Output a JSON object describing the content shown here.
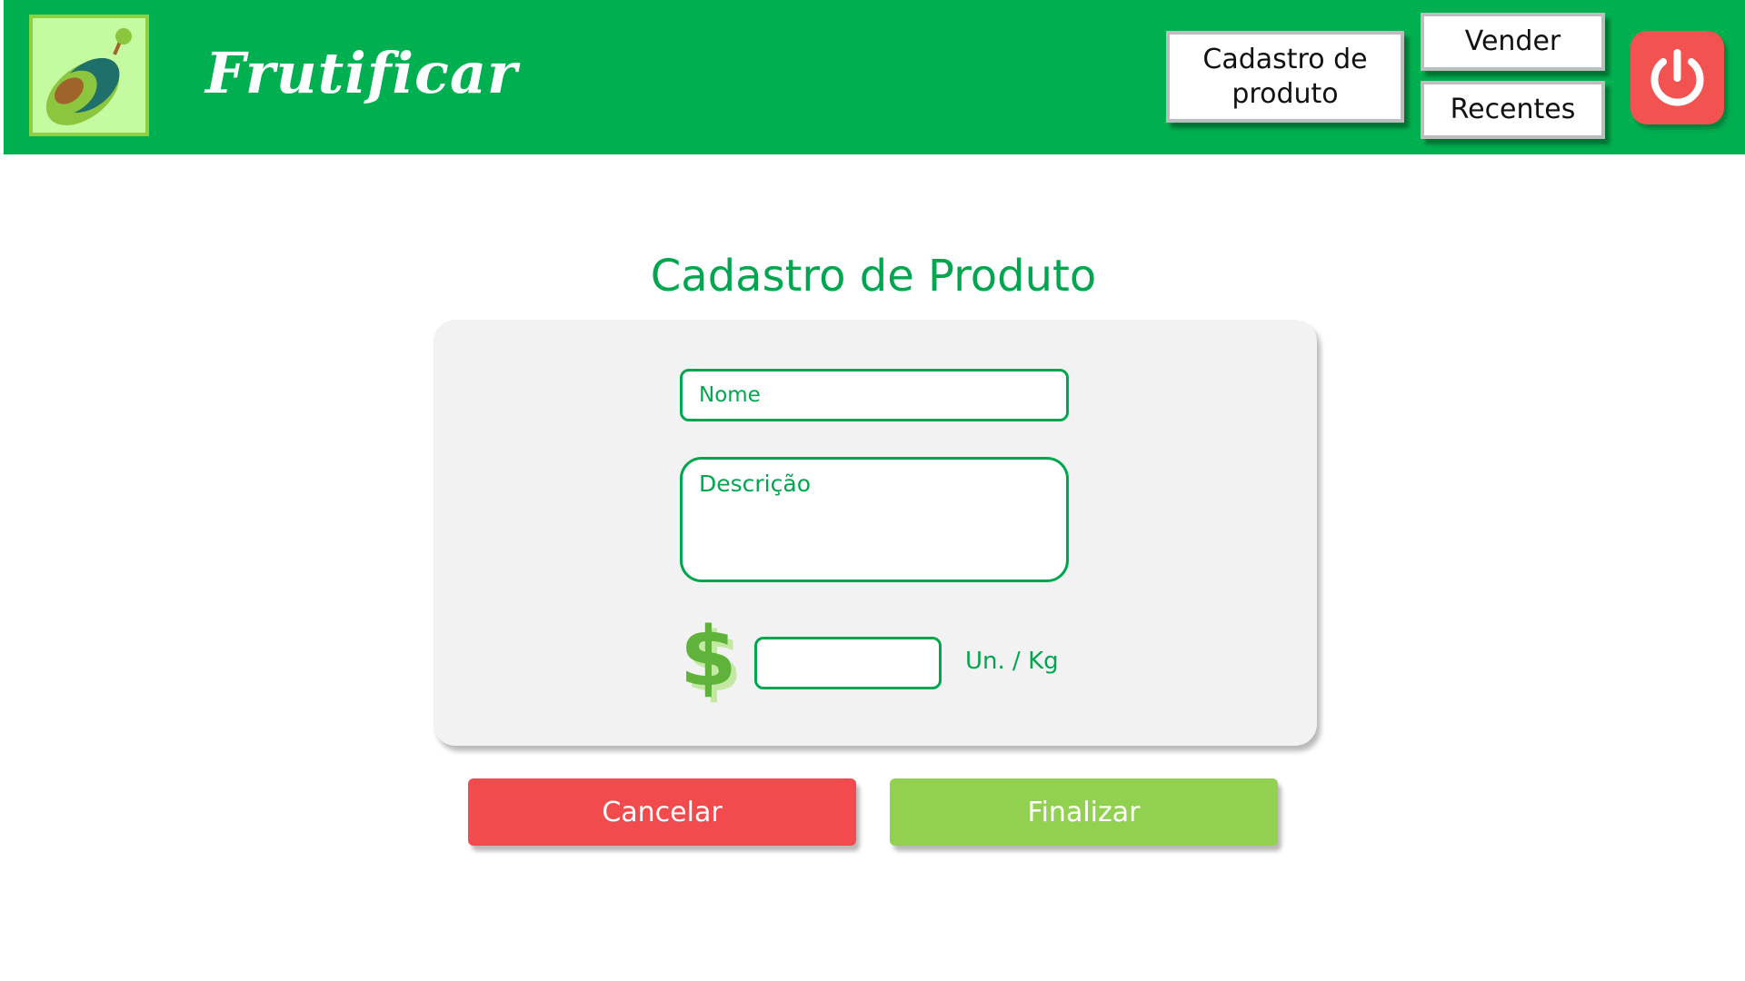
{
  "header": {
    "brand": "Frutificar",
    "logo_icon": "avocado-icon",
    "nav": {
      "cadastro_label": "Cadastro de\nproduto",
      "vender_label": "Vender",
      "recentes_label": "Recentes"
    },
    "power_icon": "power-icon"
  },
  "main": {
    "title": "Cadastro de Produto",
    "form": {
      "nome_placeholder": "Nome",
      "descricao_placeholder": "Descrição",
      "preco_value": "",
      "preco_icon": "dollar-icon",
      "unit_label": "Un. / Kg"
    },
    "actions": {
      "cancel_label": "Cancelar",
      "finish_label": "Finalizar"
    }
  },
  "colors": {
    "header_bg": "#00af50",
    "accent_green": "#00a64f",
    "cancel_red": "#f24b4e",
    "finish_green": "#92d050",
    "power_red": "#f25250",
    "card_bg": "#f2f2f2"
  }
}
